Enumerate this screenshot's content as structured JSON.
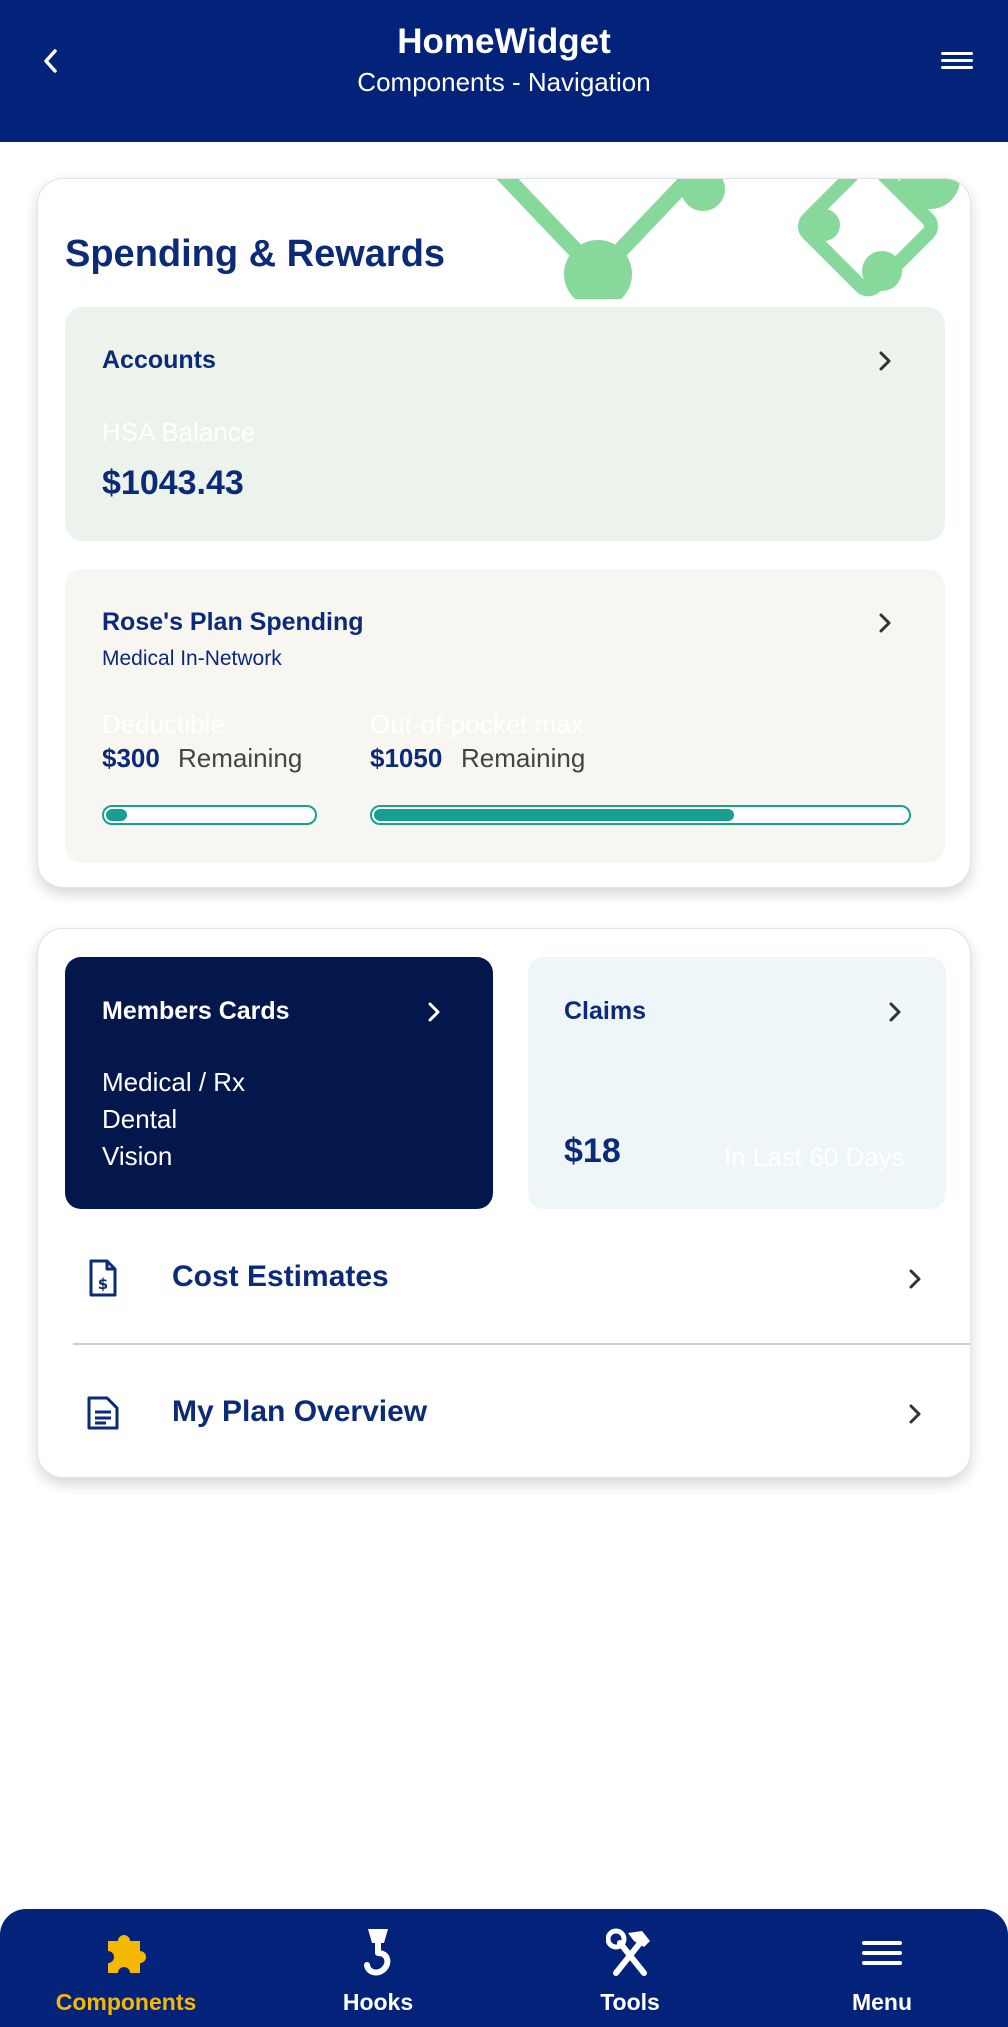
{
  "header": {
    "title": "HomeWidget",
    "subtitle": "Components - Navigation",
    "back_icon": "chevron-left-icon",
    "menu_icon": "hamburger-menu-icon"
  },
  "spending_rewards": {
    "title": "Spending & Rewards",
    "accounts": {
      "title": "Accounts",
      "balance_label": "HSA Balance",
      "balance": "$1043.43"
    },
    "plan": {
      "title": "Rose's Plan Spending",
      "subtitle": "Medical In-Network",
      "deductible": {
        "label": "Deductible",
        "amount": "$300",
        "suffix": "Remaining",
        "progress": 0.1
      },
      "oop": {
        "label": "Out-of-pocket max",
        "amount": "$1050",
        "suffix": "Remaining",
        "progress": 0.67
      }
    }
  },
  "quick_links": {
    "members_cards": {
      "title": "Members Cards",
      "items": [
        "Medical / Rx",
        "Dental",
        "Vision"
      ]
    },
    "claims": {
      "title": "Claims",
      "amount": "$18",
      "period": "In Last 60 Days"
    },
    "rows": [
      {
        "label": "Cost Estimates",
        "icon": "dollar-document-icon"
      },
      {
        "label": "My Plan Overview",
        "icon": "document-lines-icon"
      }
    ]
  },
  "tabbar": {
    "tabs": [
      {
        "label": "Components",
        "icon": "puzzle-icon",
        "active": true
      },
      {
        "label": "Hooks",
        "icon": "crane-hook-icon",
        "active": false
      },
      {
        "label": "Tools",
        "icon": "hammer-wrench-icon",
        "active": false
      },
      {
        "label": "Menu",
        "icon": "hamburger-menu-icon",
        "active": false
      }
    ]
  },
  "colors": {
    "primary": "#03237a",
    "dark_navy": "#03174d",
    "accent_yellow": "#f5b800",
    "progress_teal": "#17a090",
    "deco_green": "#86d99b"
  }
}
